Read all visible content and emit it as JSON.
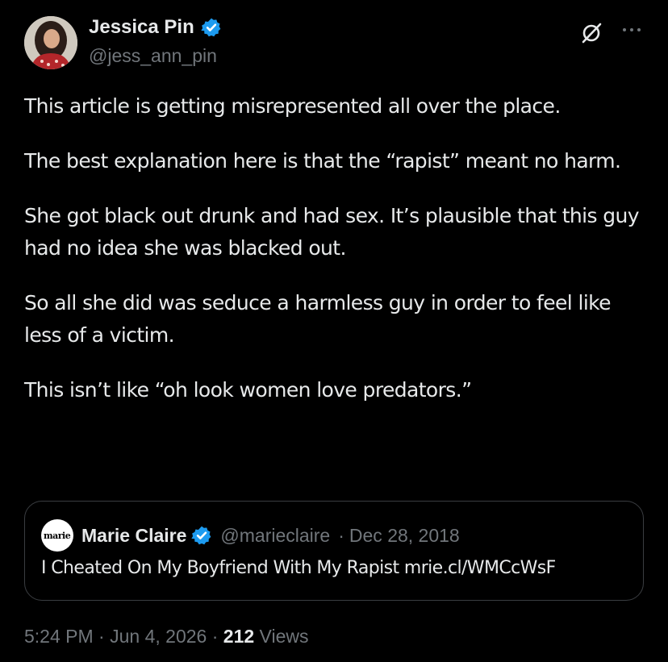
{
  "author": {
    "display_name": "Jessica Pin",
    "handle": "@jess_ann_pin",
    "verified": true
  },
  "post": {
    "paragraphs": [
      "This article is getting misrepresented all over the place.",
      "The best explanation here is that the “rapist” meant no harm.",
      "She got black out drunk and had sex. It’s plausible that this guy had no idea she was blacked out.",
      "So all she did was seduce a harmless guy in order to feel like less of a victim.",
      "This isn’t like “oh look women love predators.”"
    ]
  },
  "quoted_post": {
    "logo_text": "marie claire",
    "display_name": "Marie Claire",
    "verified": true,
    "handle": "@marieclaire",
    "separator": "·",
    "date": "Dec 28, 2018",
    "text": "I Cheated On My Boyfriend With My Rapist mrie.cl/WMCcWsF"
  },
  "footer": {
    "time": "5:24 PM",
    "separator": "·",
    "date": "Jun 4, 2026",
    "views_count": "212",
    "views_label": "Views"
  },
  "icons": {
    "grok": "grok-icon",
    "more": "more-icon",
    "verified": "verified-badge-icon"
  },
  "colors": {
    "background": "#000000",
    "text": "#e7e9ea",
    "secondary": "#71767b",
    "verified": "#1d9bf0",
    "border": "#3a3d41"
  }
}
